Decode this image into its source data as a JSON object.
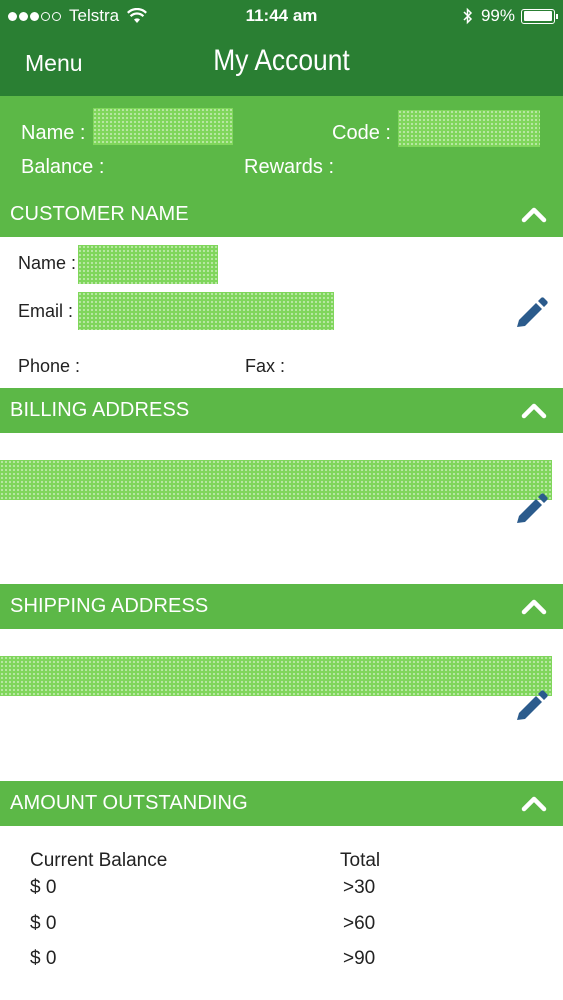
{
  "status_bar": {
    "carrier": "Telstra",
    "time": "11:44 am",
    "battery": "99%",
    "battery_level": 0.99
  },
  "nav": {
    "menu_label": "Menu",
    "title": "My Account"
  },
  "summary": {
    "name_label": "Name :",
    "code_label": "Code :",
    "balance_label": "Balance :",
    "rewards_label": "Rewards :"
  },
  "customer": {
    "header": "CUSTOMER NAME",
    "name_label": "Name :",
    "email_label": "Email :",
    "phone_label": "Phone :",
    "fax_label": "Fax :"
  },
  "billing": {
    "header": "BILLING ADDRESS"
  },
  "shipping": {
    "header": "SHIPPING ADDRESS"
  },
  "amount": {
    "header": "AMOUNT OUTSTANDING",
    "current_balance_label": "Current Balance",
    "total_label": "Total",
    "rows": [
      {
        "balance": "$ 0",
        "total": ">30"
      },
      {
        "balance": "$ 0",
        "total": ">60"
      },
      {
        "balance": "$ 0",
        "total": ">90"
      }
    ]
  },
  "colors": {
    "nav_green": "#2a7f33",
    "section_green": "#5cb847",
    "redaction_green": "#7fd65b",
    "edit_icon_blue": "#2b5b8c"
  }
}
